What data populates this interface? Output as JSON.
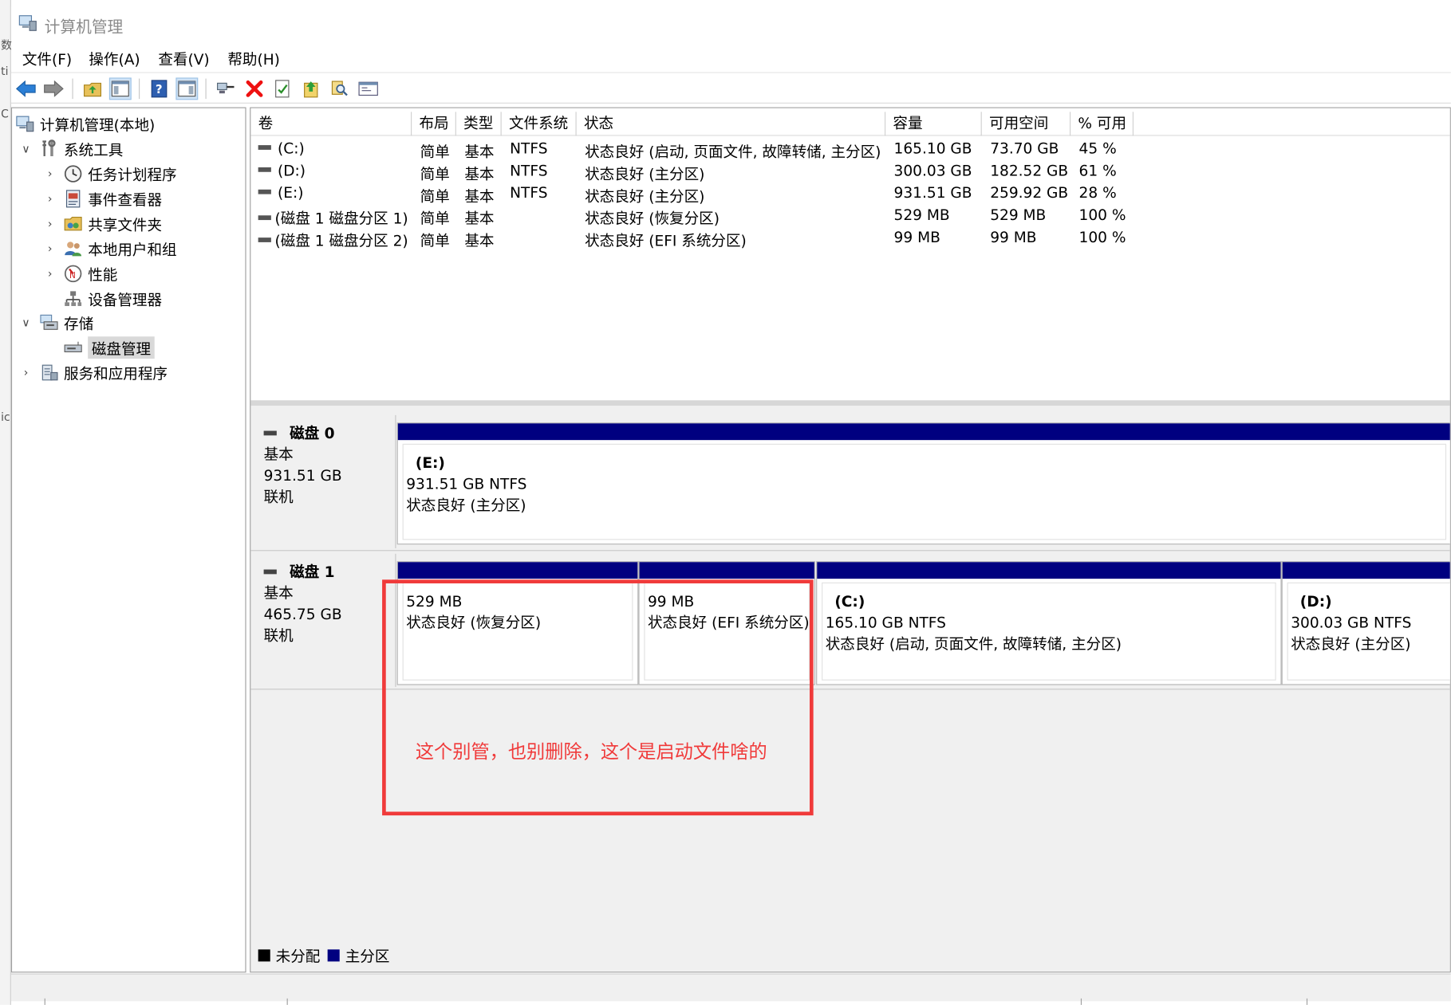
{
  "window": {
    "title": "计算机管理"
  },
  "left_strip": {
    "glyphs": [
      "数",
      "ti",
      "C",
      "ic"
    ]
  },
  "menu": [
    "文件(F)",
    "操作(A)",
    "查看(V)",
    "帮助(H)"
  ],
  "toolbar": [
    "back-arrow-icon",
    "forward-arrow-icon",
    "up-folder-icon",
    "show-hide-console-tree-icon",
    "help-icon",
    "show-action-pane-icon",
    "connect-icon",
    "delete-icon",
    "properties-icon",
    "import-icon",
    "search-icon",
    "console-icon"
  ],
  "tree": {
    "root": "计算机管理(本地)",
    "system_tools": "系统工具",
    "task_scheduler": "任务计划程序",
    "event_viewer": "事件查看器",
    "shared_folders": "共享文件夹",
    "local_users": "本地用户和组",
    "performance": "性能",
    "device_manager": "设备管理器",
    "storage": "存储",
    "disk_management": "磁盘管理",
    "services_apps": "服务和应用程序"
  },
  "volume_columns": [
    "卷",
    "布局",
    "类型",
    "文件系统",
    "状态",
    "容量",
    "可用空间",
    "% 可用"
  ],
  "volumes": [
    {
      "name": "(C:)",
      "layout": "简单",
      "type": "基本",
      "fs": "NTFS",
      "status": "状态良好 (启动, 页面文件, 故障转储, 主分区)",
      "capacity": "165.10 GB",
      "free": "73.70 GB",
      "pct": "45 %"
    },
    {
      "name": "(D:)",
      "layout": "简单",
      "type": "基本",
      "fs": "NTFS",
      "status": "状态良好 (主分区)",
      "capacity": "300.03 GB",
      "free": "182.52 GB",
      "pct": "61 %"
    },
    {
      "name": "(E:)",
      "layout": "简单",
      "type": "基本",
      "fs": "NTFS",
      "status": "状态良好 (主分区)",
      "capacity": "931.51 GB",
      "free": "259.92 GB",
      "pct": "28 %"
    },
    {
      "name": "(磁盘 1 磁盘分区 1)",
      "layout": "简单",
      "type": "基本",
      "fs": "",
      "status": "状态良好 (恢复分区)",
      "capacity": "529 MB",
      "free": "529 MB",
      "pct": "100 %"
    },
    {
      "name": "(磁盘 1 磁盘分区 2)",
      "layout": "简单",
      "type": "基本",
      "fs": "",
      "status": "状态良好 (EFI 系统分区)",
      "capacity": "99 MB",
      "free": "99 MB",
      "pct": "100 %"
    }
  ],
  "disks": [
    {
      "name": "磁盘 0",
      "type": "基本",
      "size": "931.51 GB",
      "state": "联机",
      "partitions": [
        {
          "name": "(E:)",
          "size": "931.51 GB NTFS",
          "status": "状态良好 (主分区)"
        }
      ]
    },
    {
      "name": "磁盘 1",
      "type": "基本",
      "size": "465.75 GB",
      "state": "联机",
      "partitions": [
        {
          "name": "",
          "size": "529 MB",
          "status": "状态良好 (恢复分区)"
        },
        {
          "name": "",
          "size": "99 MB",
          "status": "状态良好 (EFI 系统分区)"
        },
        {
          "name": "(C:)",
          "size": "165.10 GB NTFS",
          "status": "状态良好 (启动, 页面文件, 故障转储, 主分区)"
        },
        {
          "name": "(D:)",
          "size": "300.03 GB NTFS",
          "status": "状态良好 (主分区)"
        }
      ]
    }
  ],
  "legend": [
    {
      "label": "未分配",
      "color": "#000000"
    },
    {
      "label": "主分区",
      "color": "#000080"
    }
  ],
  "annotation": {
    "text": "这个别管，也别删除，这个是启动文件啥的",
    "color": "#f03a3a"
  }
}
